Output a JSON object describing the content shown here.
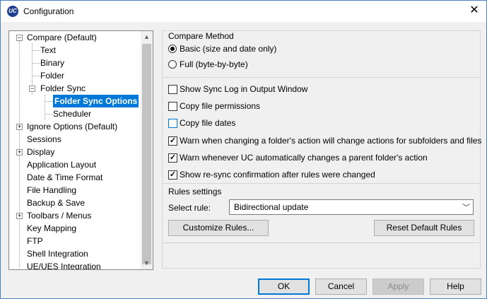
{
  "window": {
    "title": "Configuration",
    "app_icon_text": "UC"
  },
  "tree": {
    "items": [
      {
        "label": "Compare (Default)"
      },
      {
        "label": "Text"
      },
      {
        "label": "Binary"
      },
      {
        "label": "Folder"
      },
      {
        "label": "Folder Sync"
      },
      {
        "label": "Folder Sync Options"
      },
      {
        "label": "Scheduler"
      },
      {
        "label": "Ignore Options (Default)"
      },
      {
        "label": "Sessions"
      },
      {
        "label": "Display"
      },
      {
        "label": "Application Layout"
      },
      {
        "label": "Date & Time Format"
      },
      {
        "label": "File Handling"
      },
      {
        "label": "Backup & Save"
      },
      {
        "label": "Toolbars / Menus"
      },
      {
        "label": "Key Mapping"
      },
      {
        "label": "FTP"
      },
      {
        "label": "Shell Integration"
      },
      {
        "label": "UE/UES Integration"
      }
    ],
    "selected": "Folder Sync Options"
  },
  "compare_method": {
    "header": "Compare Method",
    "options": [
      {
        "label": "Basic (size and date only)",
        "selected": true
      },
      {
        "label": "Full  (byte-by-byte)",
        "selected": false
      }
    ]
  },
  "checkboxes": [
    {
      "label": "Show Sync Log in Output Window",
      "checked": false
    },
    {
      "label": "Copy file permissions",
      "checked": false
    },
    {
      "label": "Copy file dates",
      "checked": false
    },
    {
      "label": "Warn when changing a folder's action will change actions for subfolders and files",
      "checked": true
    },
    {
      "label": "Warn whenever UC automatically changes a parent folder's action",
      "checked": true
    },
    {
      "label": "Show re-sync confirmation after rules were changed",
      "checked": true
    }
  ],
  "rules_settings": {
    "header": "Rules settings",
    "select_label": "Select rule:",
    "select_value": "Bidirectional update",
    "customize_button": "Customize Rules...",
    "reset_button": "Reset Default Rules"
  },
  "footer": {
    "ok": "OK",
    "cancel": "Cancel",
    "apply": "Apply",
    "help": "Help"
  },
  "colors": {
    "selection": "#0078d7",
    "titlebar_border": "#4a7fc2"
  }
}
